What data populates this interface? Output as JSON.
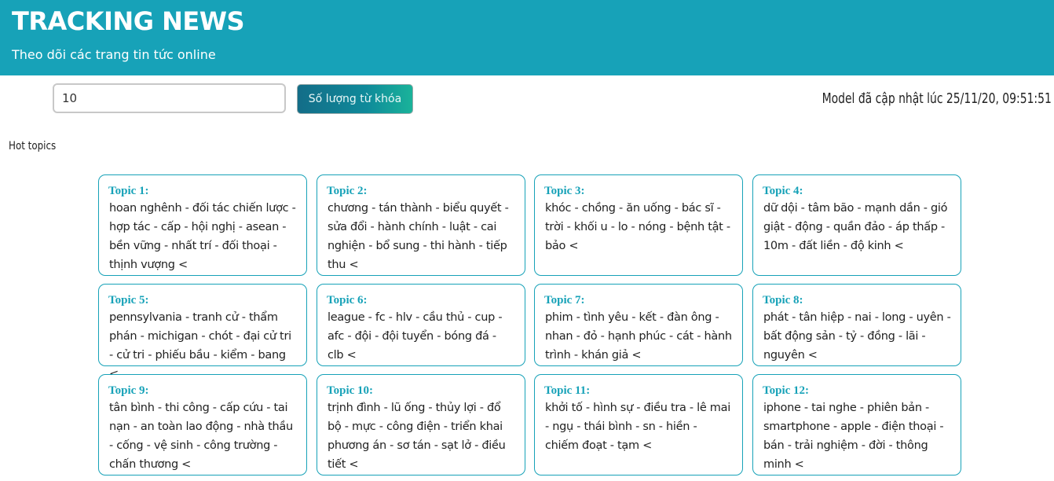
{
  "header": {
    "title": "TRACKING NEWS",
    "subtitle": "Theo dõi các trang tin tức online"
  },
  "controls": {
    "keyword_count_value": "10",
    "keyword_count_button": "Số lượng từ khóa",
    "model_updated": "Model đã cập nhật lúc 25/11/20, 09:51:51"
  },
  "section": {
    "hot_topics_label": "Hot topics"
  },
  "colors": {
    "accent": "#17a2b8",
    "button_start": "#136d88",
    "button_end": "#1ab39a"
  },
  "topics": [
    {
      "title": "Topic 1:",
      "keywords": "hoan nghênh - đối tác chiến lược - hợp tác - cấp - hội nghị - asean - bền vững - nhất trí - đối thoại - thịnh vượng <"
    },
    {
      "title": "Topic 2:",
      "keywords": "chương - tán thành - biểu quyết - sửa đổi - hành chính - luật - cai nghiện - bổ sung - thi hành - tiếp thu <"
    },
    {
      "title": "Topic 3:",
      "keywords": "khóc - chồng - ăn uống - bác sĩ - trời - khối u - lo - nóng - bệnh tật - bảo <"
    },
    {
      "title": "Topic 4:",
      "keywords": "dữ dội - tâm bão - mạnh dần - gió giật - động - quần đảo - áp thấp - 10m - đất liền - độ kinh <"
    },
    {
      "title": "Topic 5:",
      "keywords": "pennsylvania - tranh cử - thẩm phán - michigan - chót - đại cử tri - cử tri - phiếu bầu - kiểm - bang <"
    },
    {
      "title": "Topic 6:",
      "keywords": "league - fc - hlv - cầu thủ - cup - afc - đội - đội tuyển - bóng đá - clb <"
    },
    {
      "title": "Topic 7:",
      "keywords": "phim - tình yêu - kết - đàn ông - nhan - đỏ - hạnh phúc - cát - hành trình - khán giả <"
    },
    {
      "title": "Topic 8:",
      "keywords": "phát - tân hiệp - nai - long - uyên - bất động sản - tỷ - đồng - lãi - nguyên <"
    },
    {
      "title": "Topic 9:",
      "keywords": "tân bình - thi công - cấp cứu - tai nạn - an toàn lao động - nhà thầu - cống - vệ sinh - công trường - chấn thương <"
    },
    {
      "title": "Topic 10:",
      "keywords": "trịnh đình - lũ ống - thủy lợi - đổ bộ - mực - công điện - triển khai phương án - sơ tán - sạt lở - điều tiết <"
    },
    {
      "title": "Topic 11:",
      "keywords": "khởi tố - hình sự - điều tra - lê mai - ngụ - thái bình - sn - hiền - chiếm đoạt - tạm <"
    },
    {
      "title": "Topic 12:",
      "keywords": "iphone - tai nghe - phiên bản - smartphone - apple - điện thoại - bán - trải nghiệm - đời - thông minh <"
    }
  ]
}
